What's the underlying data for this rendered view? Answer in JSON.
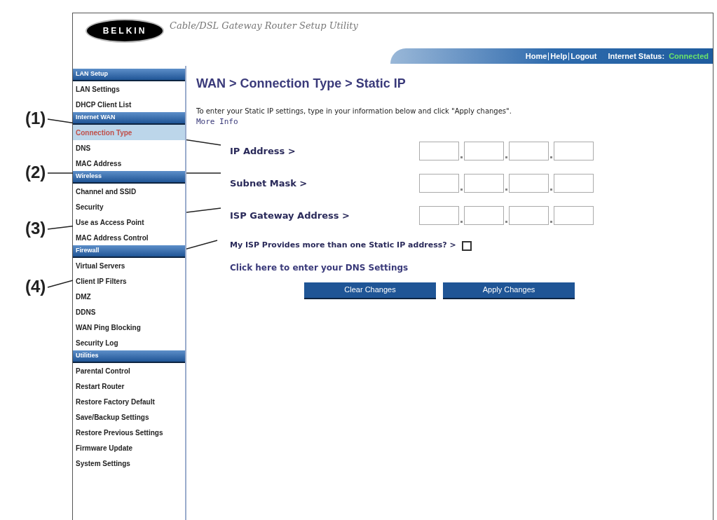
{
  "callouts": [
    {
      "label": "(1)"
    },
    {
      "label": "(2)"
    },
    {
      "label": "(3)"
    },
    {
      "label": "(4)"
    }
  ],
  "header": {
    "logo": "BELKIN",
    "title": "Cable/DSL Gateway Router Setup Utility",
    "nav": [
      "Home",
      "Help",
      "Logout"
    ],
    "status_label": "Internet Status:",
    "status_value": "Connected"
  },
  "sidebar": {
    "sections": [
      {
        "title": "LAN Setup",
        "items": [
          {
            "label": "LAN Settings",
            "selected": false
          },
          {
            "label": "DHCP Client List",
            "selected": false
          }
        ]
      },
      {
        "title": "Internet WAN",
        "items": [
          {
            "label": "Connection Type",
            "selected": true
          },
          {
            "label": "DNS",
            "selected": false
          },
          {
            "label": "MAC Address",
            "selected": false
          }
        ]
      },
      {
        "title": "Wireless",
        "items": [
          {
            "label": "Channel and SSID",
            "selected": false
          },
          {
            "label": "Security",
            "selected": false
          },
          {
            "label": "Use as Access Point",
            "selected": false
          },
          {
            "label": "MAC Address Control",
            "selected": false
          }
        ]
      },
      {
        "title": "Firewall",
        "items": [
          {
            "label": "Virtual Servers",
            "selected": false
          },
          {
            "label": "Client IP Filters",
            "selected": false
          },
          {
            "label": "DMZ",
            "selected": false
          },
          {
            "label": "DDNS",
            "selected": false
          },
          {
            "label": "WAN Ping Blocking",
            "selected": false
          },
          {
            "label": "Security Log",
            "selected": false
          }
        ]
      },
      {
        "title": "Utilities",
        "items": [
          {
            "label": "Parental Control",
            "selected": false
          },
          {
            "label": "Restart Router",
            "selected": false
          },
          {
            "label": "Restore Factory Default",
            "selected": false
          },
          {
            "label": "Save/Backup Settings",
            "selected": false
          },
          {
            "label": "Restore Previous Settings",
            "selected": false
          },
          {
            "label": "Firmware Update",
            "selected": false
          },
          {
            "label": "System Settings",
            "selected": false
          }
        ]
      }
    ]
  },
  "content": {
    "breadcrumb": "WAN > Connection Type > Static IP",
    "intro": "To enter your Static IP settings, type in your information below and click \"Apply changes\".",
    "more_info": "More Info",
    "rows": [
      {
        "kind": "ip",
        "label": "IP Address >"
      },
      {
        "kind": "ip",
        "label": "Subnet Mask >"
      },
      {
        "kind": "ip",
        "label": "ISP Gateway Address >"
      },
      {
        "kind": "checkbox",
        "label": "My ISP Provides more than one Static IP address? >",
        "checked": false
      }
    ],
    "dns_link": "Click here to enter your DNS Settings",
    "buttons": [
      "Clear Changes",
      "Apply Changes"
    ]
  }
}
